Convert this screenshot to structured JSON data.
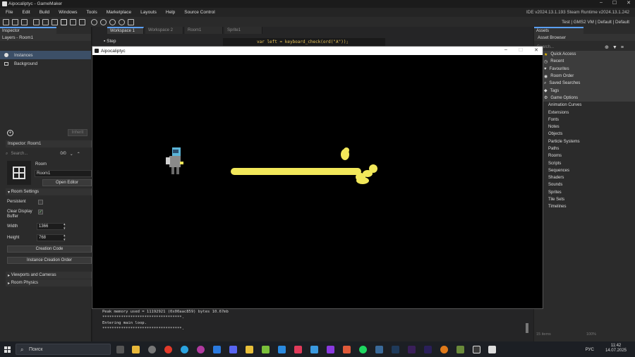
{
  "window": {
    "title": "Aipocaliptyc - GameMaker",
    "version": "IDE v2024.13.1.193 Steam  Runtime v2024.13.1.242"
  },
  "menu": [
    "File",
    "Edit",
    "Build",
    "Windows",
    "Tools",
    "Marketplace",
    "Layouts",
    "Help",
    "Source Control"
  ],
  "toolbar": {
    "target": "Test | GMS2 VM | Default | Default"
  },
  "inspector": {
    "tab": "Inspector",
    "layers_title": "Layers - Room1",
    "layers": [
      "Instances",
      "Background"
    ],
    "inherit_label": "Inherit",
    "sub_title": "Inspector: Room1",
    "search_placeholder": "Search...",
    "match_count": "0/0",
    "room_label": "Room",
    "room_name": "Room1",
    "open_editor": "Open Editor",
    "room_settings": "Room Settings",
    "persistent": "Persistent",
    "clear_display": "Clear Display",
    "buffer": "Buffer",
    "width_label": "Width",
    "width_value": "1366",
    "height_label": "Height",
    "height_value": "768",
    "creation_code": "Creation Code",
    "instance_order": "Instance Creation Order",
    "viewports": "Viewports and Cameras",
    "physics": "Room Physics"
  },
  "workspace": {
    "tabs": [
      "Workspace 1",
      "Workspace 2",
      "Room1",
      "Sprite1"
    ],
    "step_label": "Step",
    "code_line": "var  left  = keyboard_check(ord(\"A\"));"
  },
  "game_window": {
    "title": "Aipocaliptyc"
  },
  "output": [
    "Peak memory used = 11192921 (0x00aac859) bytes 10.67mb",
    "**********************************.",
    "Entering main loop.",
    "**********************************."
  ],
  "assets": {
    "tab": "Assets",
    "browser": "Asset Browser",
    "search_placeholder": "Search...",
    "quick_access": "Quick Access",
    "quick_items": [
      "Recent",
      "Favourites",
      "Room Order",
      "Saved Searches",
      "Tags",
      "Game Options"
    ],
    "groups": [
      "Animation Curves",
      "Extensions",
      "Fonts",
      "Notes",
      "Objects",
      "Particle Systems",
      "Paths",
      "Rooms",
      "Scripts",
      "Sequences",
      "Shaders",
      "Sounds",
      "Sprites",
      "Tile Sets",
      "Timelines"
    ],
    "footer_count": "15 items",
    "zoom": "100%"
  },
  "taskbar": {
    "search": "Поиск",
    "lang": "РУС",
    "time": "11:42",
    "date": "14.07.2025"
  },
  "colors": {
    "accent": "#5aa0ff",
    "laser": "#f2e85a",
    "bg": "#1e1e1e"
  }
}
